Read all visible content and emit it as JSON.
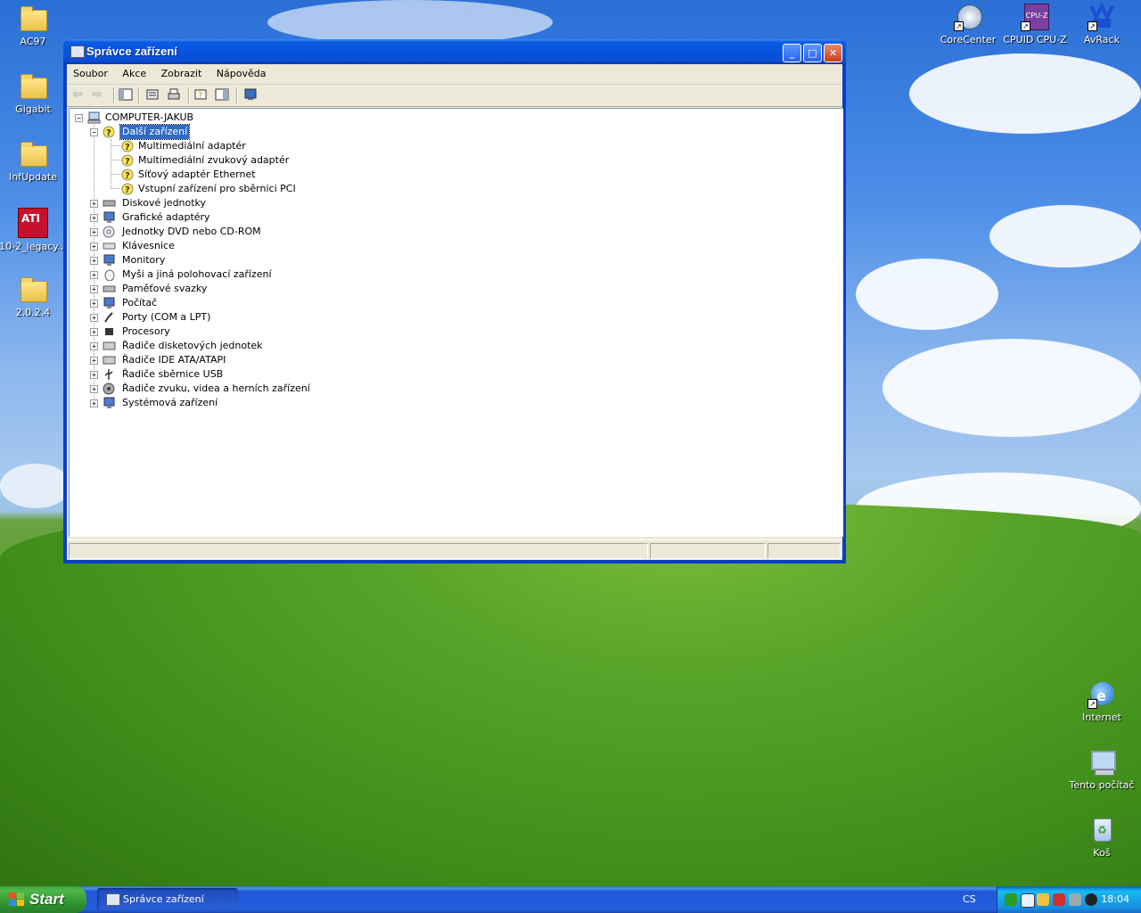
{
  "desktop": {
    "left_icons": [
      {
        "label": "AC97",
        "icon": "folder-icon"
      },
      {
        "label": "Gigabit",
        "icon": "folder-icon"
      },
      {
        "label": "InfUpdate",
        "icon": "folder-icon"
      },
      {
        "label": "10-2_legacy...",
        "icon": "ati-radeon-icon"
      },
      {
        "label": "2.0.2.4",
        "icon": "folder-icon"
      }
    ],
    "top_right_icons": [
      {
        "label": "CoreCenter",
        "icon": "corecenter-icon"
      },
      {
        "label": "CPUID CPU-Z",
        "icon": "cpuz-icon",
        "badge": "CPU-Z"
      },
      {
        "label": "AvRack",
        "icon": "avrack-icon"
      }
    ],
    "bottom_right_icons": [
      {
        "label": "Internet",
        "icon": "internet-explorer-icon"
      },
      {
        "label": "Tento počítač",
        "icon": "my-computer-icon"
      },
      {
        "label": "Koš",
        "icon": "recycle-bin-icon"
      }
    ],
    "ati_badge": "ATI"
  },
  "window": {
    "title": "Správce zařízení",
    "menu": [
      "Soubor",
      "Akce",
      "Zobrazit",
      "Nápověda"
    ],
    "controls": {
      "minimize": "_",
      "maximize": "□",
      "close": "✕"
    },
    "tree": {
      "root": "COMPUTER-JAKUB",
      "expanded_category": "Další zařízení",
      "unknown_devices": [
        "Multimediální adaptér",
        "Multimediální zvukový adaptér",
        "Síťový adaptér Ethernet",
        "Vstupní zařízení pro sběrnici PCI"
      ],
      "categories": [
        {
          "label": "Diskové jednotky",
          "icon": "disk-drive-icon"
        },
        {
          "label": "Grafické adaptéry",
          "icon": "display-adapter-icon"
        },
        {
          "label": "Jednotky DVD nebo CD-ROM",
          "icon": "dvd-drive-icon"
        },
        {
          "label": "Klávesnice",
          "icon": "keyboard-icon"
        },
        {
          "label": "Monitory",
          "icon": "monitor-icon"
        },
        {
          "label": "Myši a jiná polohovací zařízení",
          "icon": "mouse-icon"
        },
        {
          "label": "Paměťové svazky",
          "icon": "storage-volume-icon"
        },
        {
          "label": "Počítač",
          "icon": "computer-icon"
        },
        {
          "label": "Porty (COM a LPT)",
          "icon": "port-icon"
        },
        {
          "label": "Procesory",
          "icon": "processor-icon"
        },
        {
          "label": "Řadiče disketových jednotek",
          "icon": "floppy-controller-icon"
        },
        {
          "label": "Řadiče IDE ATA/ATAPI",
          "icon": "ide-controller-icon"
        },
        {
          "label": "Řadiče sběrnice USB",
          "icon": "usb-icon"
        },
        {
          "label": "Řadiče zvuku, videa a herních zařízení",
          "icon": "sound-icon"
        },
        {
          "label": "Systémová zařízení",
          "icon": "system-device-icon"
        }
      ]
    }
  },
  "taskbar": {
    "start_label": "Start",
    "task_button": "Správce zařízení",
    "language": "CS",
    "clock": "18:04"
  },
  "colors": {
    "xp_blue": "#0754de",
    "selection": "#316ac5",
    "start_green": "#3c9f3c"
  }
}
